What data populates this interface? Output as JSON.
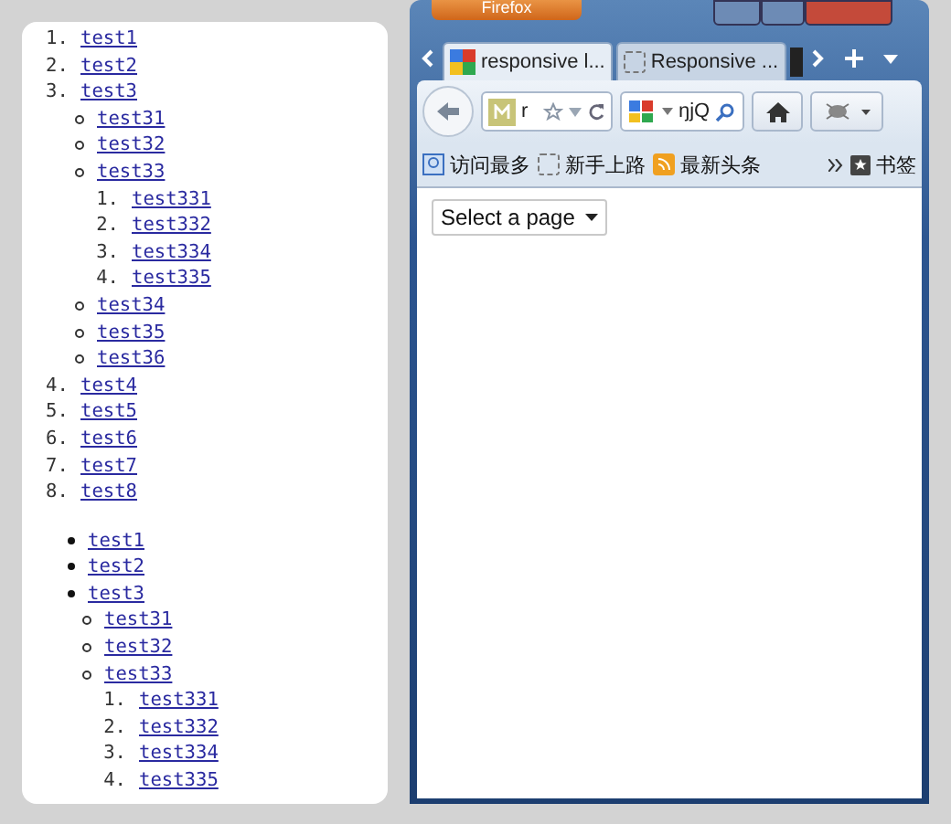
{
  "lists": [
    {
      "kind": "ordered",
      "items": [
        {
          "marker": "1.",
          "label": "test1"
        },
        {
          "marker": "2.",
          "label": "test2"
        },
        {
          "marker": "3.",
          "label": "test3",
          "children": {
            "kind": "circle",
            "items": [
              {
                "label": "test31"
              },
              {
                "label": "test32"
              },
              {
                "label": "test33",
                "children": {
                  "kind": "ordered",
                  "items": [
                    {
                      "marker": "1.",
                      "label": "test331"
                    },
                    {
                      "marker": "2.",
                      "label": "test332"
                    },
                    {
                      "marker": "3.",
                      "label": "test334"
                    },
                    {
                      "marker": "4.",
                      "label": "test335"
                    }
                  ]
                }
              },
              {
                "label": "test34"
              },
              {
                "label": "test35"
              },
              {
                "label": "test36"
              }
            ]
          }
        },
        {
          "marker": "4.",
          "label": "test4"
        },
        {
          "marker": "5.",
          "label": "test5"
        },
        {
          "marker": "6.",
          "label": "test6"
        },
        {
          "marker": "7.",
          "label": "test7"
        },
        {
          "marker": "8.",
          "label": "test8"
        }
      ]
    },
    {
      "kind": "disc",
      "items": [
        {
          "label": "test1"
        },
        {
          "label": "test2"
        },
        {
          "label": "test3",
          "children": {
            "kind": "circle",
            "items": [
              {
                "label": "test31"
              },
              {
                "label": "test32"
              },
              {
                "label": "test33",
                "children": {
                  "kind": "ordered",
                  "items": [
                    {
                      "marker": "1.",
                      "label": "test331"
                    },
                    {
                      "marker": "2.",
                      "label": "test332"
                    },
                    {
                      "marker": "3.",
                      "label": "test334"
                    },
                    {
                      "marker": "4.",
                      "label": "test335"
                    }
                  ]
                }
              }
            ]
          }
        }
      ]
    }
  ],
  "browser": {
    "app_button": "Firefox",
    "tabs": [
      {
        "label": "responsive l...",
        "selected": true
      },
      {
        "label": "Responsive ...",
        "selected": false
      }
    ],
    "address": {
      "value": "r"
    },
    "search": {
      "value": "ŋjQ"
    },
    "bookmarks": [
      "访问最多",
      "新手上路",
      "最新头条"
    ],
    "bookmarks_folder": "书签",
    "select": {
      "value": "Select a page"
    }
  }
}
